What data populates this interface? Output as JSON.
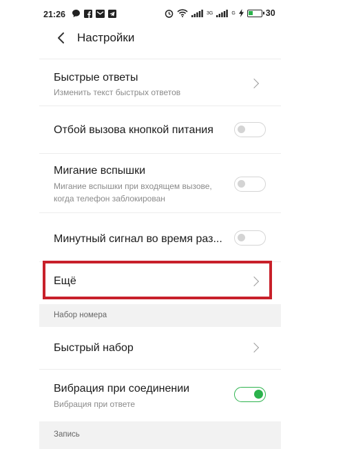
{
  "status_bar": {
    "time": "21:26",
    "signal1_sub": "3G",
    "signal2_sub": "G",
    "battery_percent": "30"
  },
  "header": {
    "title": "Настройки"
  },
  "rows": {
    "quick_replies": {
      "label": "Быстрые ответы",
      "sub": "Изменить текст быстрых ответов"
    },
    "power_end_call": {
      "label": "Отбой вызова кнопкой питания"
    },
    "flash_blink": {
      "label": "Мигание вспышки",
      "sub": "Мигание вспышки при входящем вызове, когда телефон заблокирован"
    },
    "minute_signal": {
      "label": "Минутный сигнал во время раз..."
    },
    "more": {
      "label": "Ещё"
    },
    "speed_dial": {
      "label": "Быстрый набор"
    },
    "vibrate_connect": {
      "label": "Вибрация при соединении",
      "sub": "Вибрация при ответе"
    }
  },
  "sections": {
    "dialing": "Набор номера",
    "recording": "Запись"
  },
  "toggles": {
    "power_end_call": false,
    "flash_blink": false,
    "minute_signal": false,
    "vibrate_connect": true
  },
  "colors": {
    "accent_green": "#2bb24c",
    "highlight_red": "#c8202a"
  }
}
